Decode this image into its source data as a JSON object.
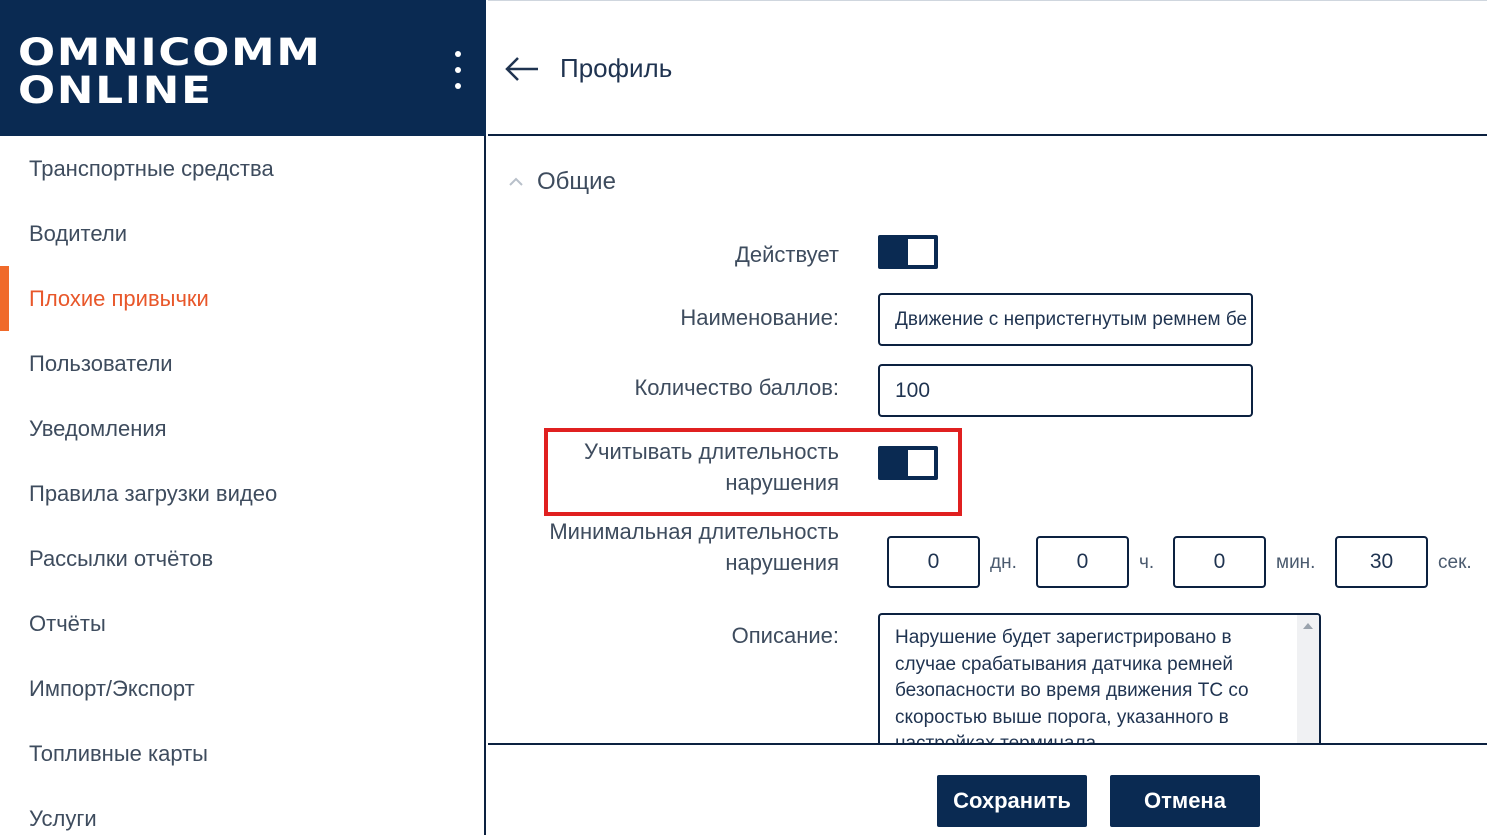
{
  "brand": {
    "line1": "OMNICOMM",
    "line2": "ONLINE"
  },
  "sidebar": {
    "items": [
      {
        "label": "Транспортные средства"
      },
      {
        "label": "Водители"
      },
      {
        "label": "Плохие привычки",
        "active": true
      },
      {
        "label": "Пользователи"
      },
      {
        "label": "Уведомления"
      },
      {
        "label": "Правила загрузки видео"
      },
      {
        "label": "Рассылки отчётов"
      },
      {
        "label": "Отчёты"
      },
      {
        "label": "Импорт/Экспорт"
      },
      {
        "label": "Топливные карты"
      },
      {
        "label": "Услуги"
      }
    ]
  },
  "header": {
    "title": "Профиль"
  },
  "section": {
    "title": "Общие",
    "expanded": true
  },
  "form": {
    "active_label": "Действует",
    "active_on": true,
    "name_label": "Наименование:",
    "name_value": "Движение с непристегнутым ремнем бе",
    "points_label": "Количество баллов:",
    "points_value": "100",
    "duration_label_1": "Учитывать длительность",
    "duration_label_2": "нарушения",
    "duration_on": true,
    "min_label_1": "Минимальная длительность",
    "min_label_2": "нарушения",
    "days_value": "0",
    "days_unit": "дн.",
    "hours_value": "0",
    "hours_unit": "ч.",
    "minutes_value": "0",
    "minutes_unit": "мин.",
    "seconds_value": "30",
    "seconds_unit": "сек.",
    "desc_label": "Описание:",
    "desc_value": "Нарушение будет зарегистрировано в\nслучае срабатывания датчика ремней\nбезопасности во время движения ТС со\nскоростью выше порога, указанного в\nнастройках терминала"
  },
  "footer": {
    "save_label": "Сохранить",
    "cancel_label": "Отмена"
  },
  "colors": {
    "navy": "#0a2a52",
    "accent": "#f06a2a",
    "highlight": "#e02020"
  }
}
